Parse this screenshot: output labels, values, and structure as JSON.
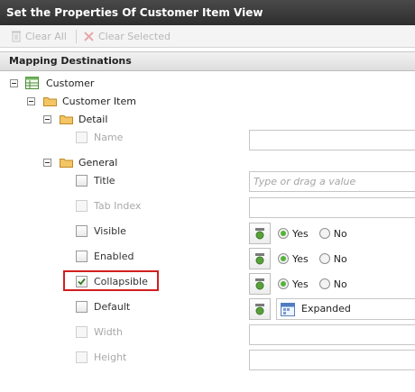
{
  "title": "Set the Properties Of Customer Item View",
  "toolbar": {
    "clear_all": "Clear All",
    "clear_selected": "Clear Selected"
  },
  "section": "Mapping Destinations",
  "tree": {
    "root": "Customer",
    "item": "Customer Item",
    "detail": "Detail",
    "general": "General"
  },
  "props": {
    "name": "Name",
    "title": "Title",
    "title_placeholder": "Type or drag a value",
    "tab_index": "Tab Index",
    "visible": "Visible",
    "enabled": "Enabled",
    "collapsible": "Collapsible",
    "default": "Default",
    "default_value": "Expanded",
    "width": "Width",
    "height": "Height"
  },
  "radio": {
    "yes": "Yes",
    "no": "No"
  },
  "states": {
    "collapsible_checked": true,
    "visible_value": "Yes",
    "enabled_value": "Yes",
    "collapsible_value": "Yes"
  },
  "colors": {
    "highlight": "#d11f1f",
    "radio_selected": "#55b23a",
    "titlebar": "#3a3a3a"
  }
}
